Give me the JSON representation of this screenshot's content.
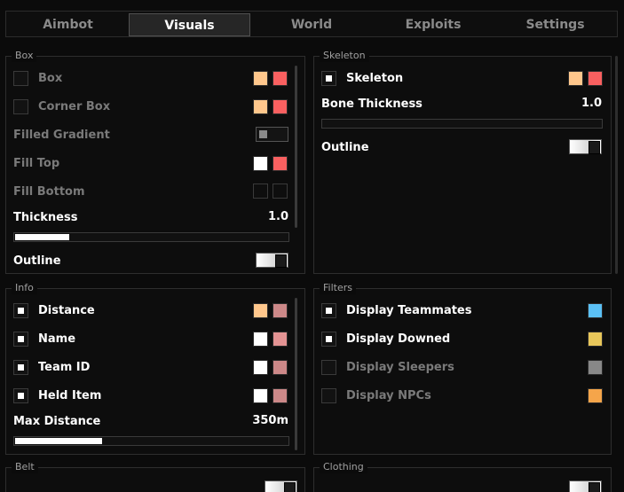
{
  "tabs": [
    {
      "label": "Aimbot",
      "active": false
    },
    {
      "label": "Visuals",
      "active": true
    },
    {
      "label": "World",
      "active": false
    },
    {
      "label": "Exploits",
      "active": false
    },
    {
      "label": "Settings",
      "active": false
    }
  ],
  "box": {
    "title": "Box",
    "box_label": "Box",
    "corner_box_label": "Corner Box",
    "filled_gradient_label": "Filled Gradient",
    "fill_top_label": "Fill Top",
    "fill_bottom_label": "Fill Bottom",
    "thickness_label": "Thickness",
    "thickness_value": "1.0",
    "thickness_fraction": 0.2,
    "outline_label": "Outline",
    "colors": {
      "box_primary": "#ffc78c",
      "box_secondary": "#f96060",
      "corner_primary": "#ffc78c",
      "corner_secondary": "#f96060",
      "fill_top_primary": "#ffffff",
      "fill_top_secondary": "#f96060",
      "fill_bottom_primary": "#0e0e0e",
      "fill_bottom_secondary": "#0e0e0e"
    }
  },
  "skeleton": {
    "title": "Skeleton",
    "skeleton_label": "Skeleton",
    "bone_thickness_label": "Bone Thickness",
    "bone_thickness_value": "1.0",
    "bone_thickness_fraction": 0.0,
    "outline_label": "Outline",
    "colors": {
      "primary": "#ffc78c",
      "secondary": "#f96060"
    }
  },
  "info": {
    "title": "Info",
    "distance_label": "Distance",
    "name_label": "Name",
    "team_id_label": "Team ID",
    "held_item_label": "Held Item",
    "max_distance_label": "Max Distance",
    "max_distance_value": "350m",
    "max_distance_fraction": 0.32,
    "colors": {
      "distance_primary": "#ffc78c",
      "distance_secondary": "#cc8888",
      "name_primary": "#ffffff",
      "name_secondary": "#e39393",
      "team_primary": "#ffffff",
      "team_secondary": "#cc8888",
      "held_primary": "#ffffff",
      "held_secondary": "#cc8888"
    }
  },
  "filters": {
    "title": "Filters",
    "teammates_label": "Display Teammates",
    "downed_label": "Display Downed",
    "sleepers_label": "Display Sleepers",
    "npcs_label": "Display NPCs",
    "colors": {
      "teammates": "#5bc0f5",
      "downed": "#e8c65a",
      "sleepers": "#888888",
      "npcs": "#f5a54a"
    }
  },
  "belt": {
    "title": "Belt"
  },
  "clothing": {
    "title": "Clothing"
  }
}
